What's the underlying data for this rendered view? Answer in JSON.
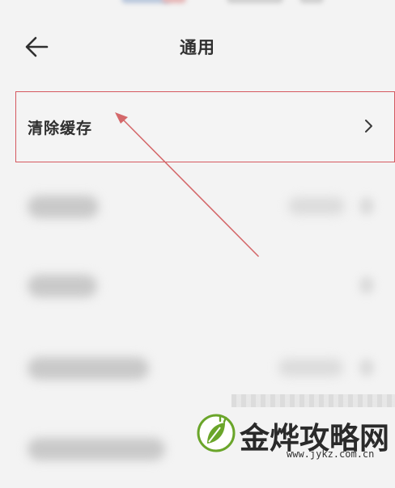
{
  "header": {
    "back_icon": "arrow-left-icon",
    "title": "通用"
  },
  "clear_cache": {
    "label": "清除缓存",
    "chevron_icon": "chevron-right-icon",
    "highlight_color": "#d5585f"
  },
  "annotation": {
    "type": "arrow",
    "color": "#d4686a"
  },
  "watermark": {
    "brand": "金烨攻略网",
    "url": "www.jykz.com.cn",
    "logo_icon": "leaf-plug-logo-icon",
    "brand_color": "#6aa52a"
  },
  "colors": {
    "background": "#f3f3f3",
    "text": "#2e2e2e"
  }
}
